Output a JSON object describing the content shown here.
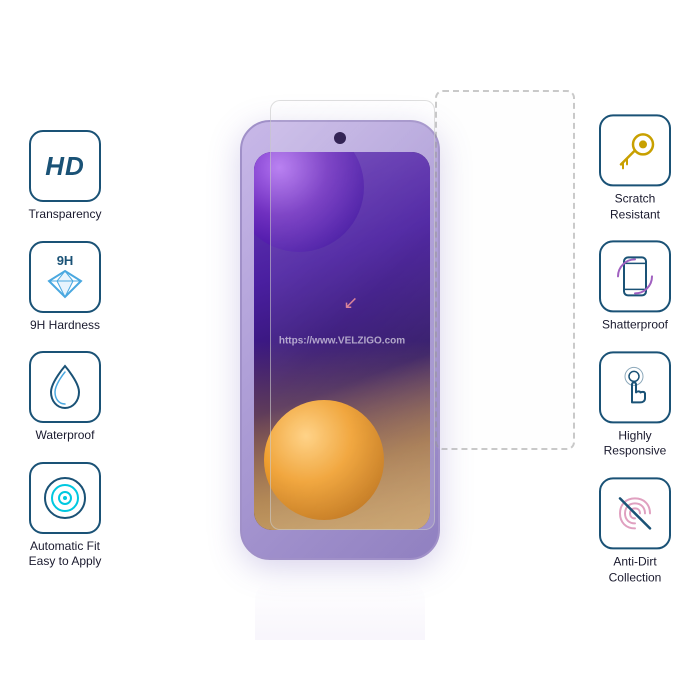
{
  "features": {
    "left": [
      {
        "id": "hd",
        "label": "Transparency",
        "icon_type": "hd"
      },
      {
        "id": "9h",
        "label": "9H Hardness",
        "icon_type": "9h"
      },
      {
        "id": "waterproof",
        "label": "Waterproof",
        "icon_type": "waterdrop"
      },
      {
        "id": "autofit",
        "label": "Automatic Fit\nEasy to Apply",
        "icon_type": "target"
      }
    ],
    "right": [
      {
        "id": "scratch",
        "label": "Scratch\nResistant",
        "icon_type": "key"
      },
      {
        "id": "shatterproof",
        "label": "Shatterproof",
        "icon_type": "shatter"
      },
      {
        "id": "responsive",
        "label": "Highly\nResponsive",
        "icon_type": "hand"
      },
      {
        "id": "antidirt",
        "label": "Anti-Dirt\nCollection",
        "icon_type": "fingerprint"
      }
    ]
  },
  "watermark": "https://www.VELZIGO.com",
  "brand": "VELZIGO"
}
